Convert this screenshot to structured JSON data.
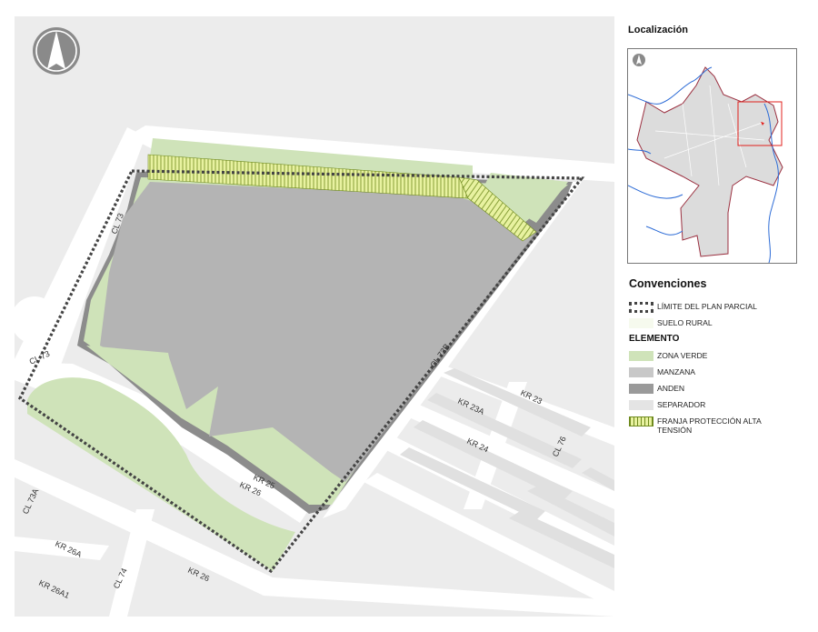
{
  "map": {
    "north_arrow": "north-arrow-icon",
    "street_labels": {
      "cl73_top": "CL 73",
      "cl73_left": "CL 73",
      "cl73b": "CL 73B",
      "kr23": "KR 23",
      "kr23a": "KR 23A",
      "kr24": "KR 24",
      "cl76": "CL 76",
      "kr25": "KR 25",
      "kr26_mid": "KR 26",
      "cl73a": "CL 73A",
      "kr26a": "KR 26A",
      "cl74": "CL 74",
      "kr26_bottom": "KR 26",
      "kr26a1": "KR 26A1"
    },
    "colors": {
      "background": "#ececec",
      "zona_verde": "#cfe3b9",
      "manzana": "#b4b4b4",
      "anden": "#8c8c8c",
      "separador": "#e6e6e6",
      "franja_fill": "#e8f2a0",
      "limite": "#444444"
    }
  },
  "localizacion": {
    "title": "Localización",
    "north_arrow": "north-arrow-icon",
    "outline_color": "#9b3040",
    "river_color": "#2c6bd6",
    "highlight_color": "#e0201c"
  },
  "legend": {
    "title": "Convenciones",
    "items": [
      {
        "label": "LÍMITE DEL PLAN PARCIAL",
        "kind": "limite"
      },
      {
        "label": "SUELO RURAL",
        "kind": "suelo",
        "color": "#f6faee"
      }
    ],
    "element_title": "ELEMENTO",
    "elements": [
      {
        "label": "ZONA VERDE",
        "color": "#cfe3b9"
      },
      {
        "label": "MANZANA",
        "color": "#c8c8c8"
      },
      {
        "label": "ANDEN",
        "color": "#9a9a9a"
      },
      {
        "label": "SEPARADOR",
        "color": "#e4e4e4"
      },
      {
        "label": "FRANJA PROTECCIÓN ALTA TENSIÓN",
        "color": "#e8f2a0"
      }
    ]
  }
}
